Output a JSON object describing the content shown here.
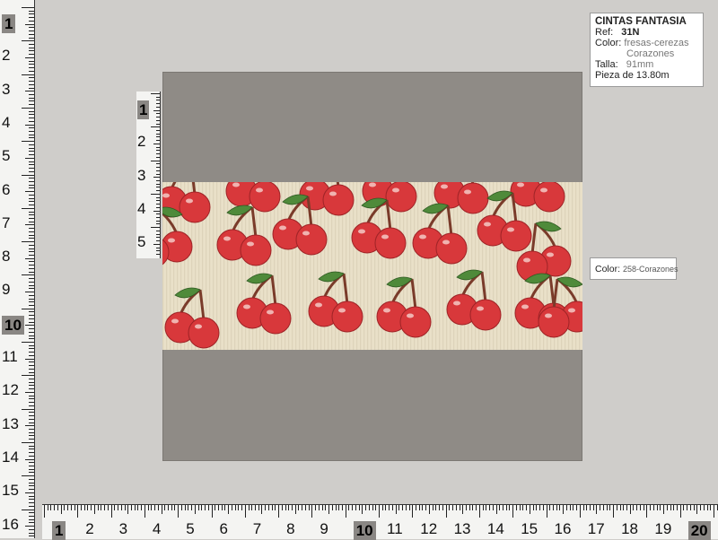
{
  "info": {
    "title": "CINTAS FANTASIA",
    "ref_label": "Ref:",
    "ref_value": "31N",
    "color_label": "Color:",
    "color_value": "fresas-cerezas",
    "color_value_2": "Corazones",
    "size_label": "Talla:",
    "size_value": "91mm",
    "piece": "Pieza de 13.80m"
  },
  "swatch": {
    "color_label": "Color:",
    "color_value": "258-Corazones"
  },
  "ruler_left": {
    "labels": [
      "1",
      "2",
      "3",
      "4",
      "5",
      "6",
      "7",
      "8",
      "9",
      "10",
      "11",
      "12",
      "13",
      "14",
      "15",
      "16"
    ],
    "highlighted": [
      "1",
      "10"
    ]
  },
  "ruler_small": {
    "labels": [
      "1",
      "2",
      "3",
      "4",
      "5"
    ],
    "highlighted": [
      "1"
    ]
  },
  "ruler_bottom": {
    "labels": [
      "1",
      "2",
      "3",
      "4",
      "5",
      "6",
      "7",
      "8",
      "9",
      "10",
      "11",
      "12",
      "13",
      "14",
      "15",
      "16",
      "17",
      "18",
      "19",
      "20"
    ],
    "highlighted": [
      "1",
      "10",
      "20"
    ]
  },
  "colors": {
    "background": "#cfcdca",
    "panel": "#8f8b86",
    "ribbon": "#e9e0c8",
    "cherry": "#d8383b",
    "leaf": "#4f8a3a",
    "stem": "#7a3b2a"
  }
}
